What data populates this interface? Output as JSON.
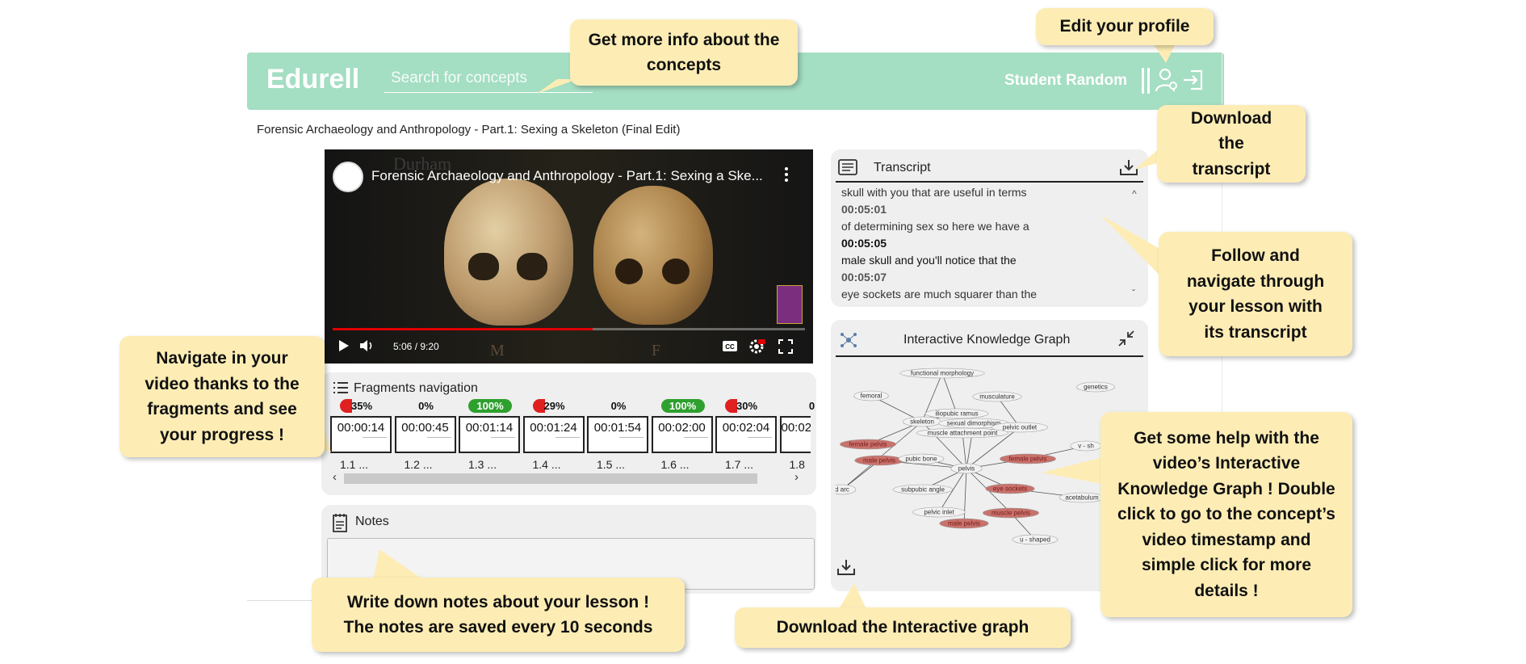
{
  "header": {
    "logo": "Edurell",
    "search_placeholder": "Search for concepts",
    "user_name": "Student Random",
    "profile_icon": "person-gear-icon",
    "logout_icon": "sign-out-icon"
  },
  "lesson_title": "Forensic Archaeology and Anthropology - Part.1: Sexing a Skeleton (Final Edit)",
  "video": {
    "title": "Forensic Archaeology and Anthropology - Part.1: Sexing a Ske...",
    "time": "5:06 / 9:20",
    "progress": 0.55,
    "watermark": "Durham",
    "skull_labels": [
      "M",
      "F"
    ],
    "icons": [
      "play-icon",
      "volume-icon",
      "cc-icon",
      "settings-icon",
      "fullscreen-icon",
      "more-icon"
    ]
  },
  "fragments": {
    "title": "Fragments navigation",
    "items": [
      {
        "badge": "35%",
        "time": "00:00:14",
        "label": "1.1 ...",
        "status": "partial"
      },
      {
        "badge": "0%",
        "time": "00:00:45",
        "label": "1.2 ...",
        "status": "none"
      },
      {
        "badge": "100%",
        "time": "00:01:14",
        "label": "1.3 ...",
        "status": "complete"
      },
      {
        "badge": "29%",
        "time": "00:01:24",
        "label": "1.4 ...",
        "status": "partial"
      },
      {
        "badge": "0%",
        "time": "00:01:54",
        "label": "1.5 ...",
        "status": "none"
      },
      {
        "badge": "100%",
        "time": "00:02:00",
        "label": "1.6 ...",
        "status": "complete"
      },
      {
        "badge": "30%",
        "time": "00:02:04",
        "label": "1.7 ...",
        "status": "partial"
      },
      {
        "badge": "0",
        "time": "00:02",
        "label": "1.8",
        "status": "none"
      }
    ],
    "scroll_left": "‹",
    "scroll_right": "›"
  },
  "notes": {
    "title": "Notes"
  },
  "transcript": {
    "title": "Transcript",
    "lines": [
      {
        "type": "text",
        "value": "skull with you that are useful in terms"
      },
      {
        "type": "ts",
        "value": "00:05:01"
      },
      {
        "type": "text",
        "value": "of determining sex so here we have a"
      },
      {
        "type": "ts",
        "value": "00:05:05",
        "active": true
      },
      {
        "type": "text",
        "value": "male skull and you'll notice that the",
        "active": true
      },
      {
        "type": "ts",
        "value": "00:05:07"
      },
      {
        "type": "text",
        "value": "eye sockets are much squarer than the"
      }
    ]
  },
  "graph": {
    "title": "Interactive Knowledge Graph",
    "nodes": [
      "functional morphology",
      "femoral",
      "musculature",
      "genetics",
      "iliopubic ramus",
      "skeleton",
      "sexual dimorphism",
      "pelvic outlet",
      "muscle attachment point",
      "female pelvis",
      "male pelvis",
      "pubic bone",
      "pelvis",
      "female pelvis",
      "v - sh",
      "eye sockets",
      "acetabulum",
      "d arc",
      "subpubic angle",
      "pelvic inlet",
      "male pelvis",
      "muscle pelvis",
      "u - shaped"
    ],
    "colors": {
      "highlight": "#c8726c",
      "normal": "#f2f2f2"
    }
  },
  "callouts": {
    "concepts": "Get more info about the concepts",
    "profile": "Edit your profile",
    "download_transcript": "Download the transcript",
    "follow_transcript": "Follow and navigate through your lesson with its transcript",
    "fragments": "Navigate in your video thanks to the fragments and see your progress !",
    "graph_help": "Get some help with the video’s Interactive Knowledge Graph ! Double click to go to the concept’s video timestamp and simple click for more details !",
    "notes": "Write down notes about your lesson ! The notes are saved every 10 seconds",
    "download_graph": "Download the Interactive graph"
  },
  "colors": {
    "header": "#a4dec3",
    "callout": "#fdedb5",
    "badge_partial": "#e02020",
    "badge_complete": "#2ea02e",
    "progress": "#e00000"
  }
}
